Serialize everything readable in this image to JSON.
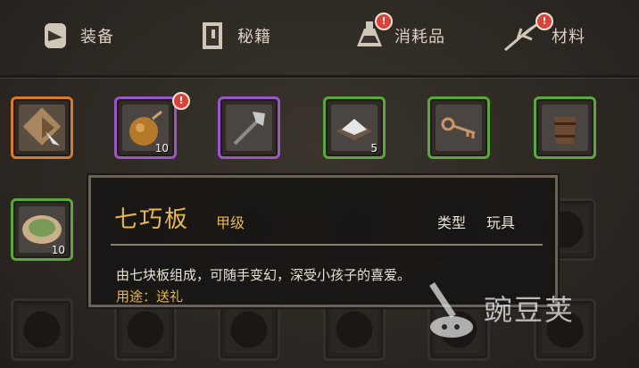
{
  "tabs": [
    {
      "label": "装备",
      "icon": "equipment-icon",
      "badge": ""
    },
    {
      "label": "秘籍",
      "icon": "book-icon",
      "badge": ""
    },
    {
      "label": "消耗品",
      "icon": "potion-icon",
      "badge": "!"
    },
    {
      "label": "材料",
      "icon": "herb-icon",
      "badge": "!"
    }
  ],
  "row1": [
    {
      "rarity": "orange",
      "icon": "tangram-board-icon",
      "count": "",
      "badge": ""
    },
    {
      "rarity": "purple",
      "icon": "bomb-gourd-icon",
      "count": "10",
      "badge": "!"
    },
    {
      "rarity": "purple",
      "icon": "axe-icon",
      "count": "",
      "badge": ""
    },
    {
      "rarity": "green",
      "icon": "salt-pile-icon",
      "count": "5",
      "badge": ""
    },
    {
      "rarity": "green",
      "icon": "key-icon",
      "count": "",
      "badge": ""
    },
    {
      "rarity": "green",
      "icon": "wooden-bucket-icon",
      "count": "",
      "badge": ""
    }
  ],
  "row2": [
    {
      "rarity": "green",
      "icon": "herb-dish-icon",
      "count": "10"
    }
  ],
  "tooltip": {
    "name": "七巧板",
    "grade": "甲级",
    "type_label": "类型",
    "type_value": "玩具",
    "description": "由七块板组成，可随手变幻，深受小孩子的喜爱。",
    "usage": "用途：送礼"
  },
  "watermark": "豌豆荚",
  "colors": {
    "gold": "#e7b84a",
    "orange": "#d9792c",
    "purple": "#9c55c9",
    "green": "#5aa83c",
    "badge": "#d9433a"
  }
}
